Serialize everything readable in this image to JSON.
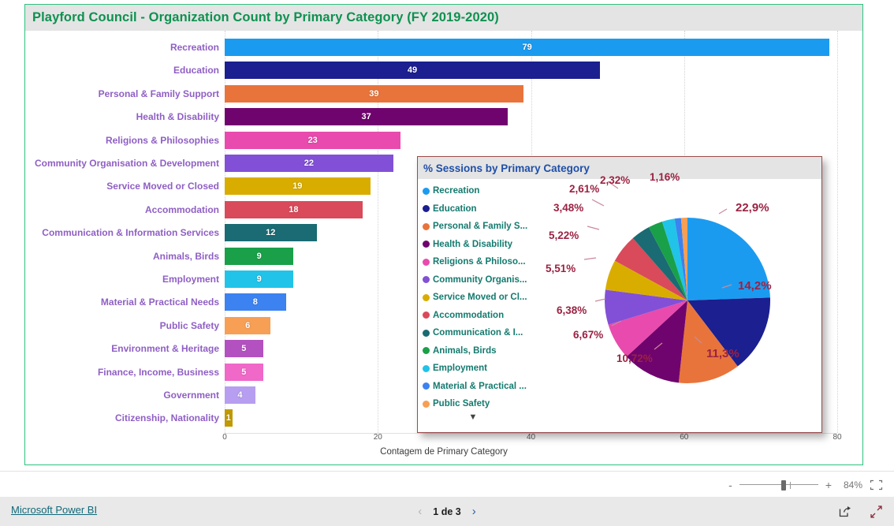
{
  "report": {
    "bar_visual": {
      "title": "Playford Council - Organization Count by Primary Category (FY 2019-2020)"
    },
    "pie_visual": {
      "title": "% Sessions by Primary Category",
      "more_icon": "chevron-down-icon"
    }
  },
  "zoom_bar": {
    "minus_label": "-",
    "plus_label": "+",
    "percent": "84%",
    "fit_icon": "fit-to-page-icon"
  },
  "footer": {
    "brand_link": "Microsoft Power BI",
    "prev_label": "‹",
    "next_label": "›",
    "page_indicator": "1 de 3",
    "share_icon": "share-icon",
    "fullscreen_icon": "fullscreen-icon"
  },
  "chart_data": [
    {
      "type": "bar",
      "orientation": "horizontal",
      "title": "Playford Council - Organization Count by Primary Category (FY 2019-2020)",
      "xlabel": "Contagem de Primary Category",
      "ylabel": "",
      "xlim": [
        0,
        80
      ],
      "xticks": [
        0,
        20,
        40,
        60,
        80
      ],
      "grid": true,
      "categories": [
        "Recreation",
        "Education",
        "Personal & Family Support",
        "Health & Disability",
        "Religions & Philosophies",
        "Community Organisation & Development",
        "Service Moved or Closed",
        "Accommodation",
        "Communication & Information Services",
        "Animals, Birds",
        "Employment",
        "Material & Practical Needs",
        "Public Safety",
        "Environment & Heritage",
        "Finance, Income, Business",
        "Government",
        "Citizenship, Nationality"
      ],
      "values": [
        79,
        49,
        39,
        37,
        23,
        22,
        19,
        18,
        12,
        9,
        9,
        8,
        6,
        5,
        5,
        4,
        1
      ],
      "colors": [
        "#1b9bf0",
        "#1b1f8f",
        "#e8743b",
        "#70046e",
        "#e84bad",
        "#8250d6",
        "#d9ad00",
        "#d94a5a",
        "#1a6b73",
        "#1aa049",
        "#21c3e8",
        "#3c82f0",
        "#f79f55",
        "#b451c0",
        "#f068c8",
        "#b79ef0",
        "#c09a00"
      ]
    },
    {
      "type": "pie",
      "title": "% Sessions by Primary Category",
      "legend_position": "left",
      "labels": [
        "Recreation",
        "Education",
        "Personal & Family S...",
        "Health & Disability",
        "Religions & Philoso...",
        "Community Organis...",
        "Service Moved or Cl...",
        "Accommodation",
        "Communication & I...",
        "Animals, Birds",
        "Employment",
        "Material & Practical ...",
        "Public Safety"
      ],
      "values": [
        22.9,
        14.2,
        11.3,
        10.72,
        6.67,
        6.38,
        5.51,
        5.22,
        3.48,
        2.61,
        2.32,
        1.16,
        1.16
      ],
      "value_labels": [
        "22,9%",
        "14,2%",
        "11,3%",
        "10,72%",
        "6,67%",
        "6,38%",
        "5,51%",
        "5,22%",
        "3,48%",
        "2,61%",
        "2,32%",
        "1,16%"
      ],
      "colors": [
        "#1b9bf0",
        "#1b1f8f",
        "#e8743b",
        "#70046e",
        "#e84bad",
        "#8250d6",
        "#d9ad00",
        "#d94a5a",
        "#1a6b73",
        "#1aa049",
        "#21c3e8",
        "#3c82f0",
        "#f79f55",
        "#b451c0",
        "#f068c8",
        "#b79ef0",
        "#c09a00"
      ]
    }
  ]
}
